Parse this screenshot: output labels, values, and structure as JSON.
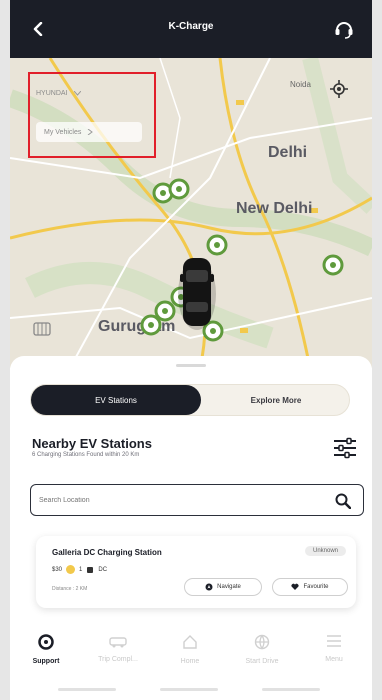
{
  "header": {
    "title": "K-Charge"
  },
  "map": {
    "labels": {
      "delhi": "Delhi",
      "new_delhi": "New Delhi",
      "gurugram": "Gurugram",
      "faridabad": "Noida"
    },
    "filter": {
      "select_value": "HYUNDAI",
      "vehicle_link": "My Vehicles"
    }
  },
  "tabs": {
    "ev_stations": "EV Stations",
    "explore": "Explore More"
  },
  "nearby": {
    "title": "Nearby EV Stations",
    "subtitle": "6 Charging Stations Found within 20 Km"
  },
  "search": {
    "placeholder": "Search Location"
  },
  "station": {
    "name": "Galleria DC Charging Station",
    "status": "Unknown",
    "power": "$30",
    "connectors": "1",
    "type": "DC",
    "distance": "Distance : 2 KM",
    "navigate_label": "Navigate",
    "favourite_label": "Favourite"
  },
  "nav": {
    "items": [
      {
        "label": "Support",
        "icon": "support-icon",
        "active": true
      },
      {
        "label": "Trip Compl...",
        "icon": "car-icon",
        "active": false
      },
      {
        "label": "Home",
        "icon": "home-icon",
        "active": false
      },
      {
        "label": "Start Drive",
        "icon": "globe-icon",
        "active": false
      },
      {
        "label": "Menu",
        "icon": "menu-icon",
        "active": false
      }
    ]
  },
  "colors": {
    "header_bg": "#1b1e27",
    "map_bg": "#e9e4d8",
    "pin_green": "#5f9a3c",
    "highlight_red": "#e11f2a",
    "road_yellow": "#f2c94c"
  }
}
